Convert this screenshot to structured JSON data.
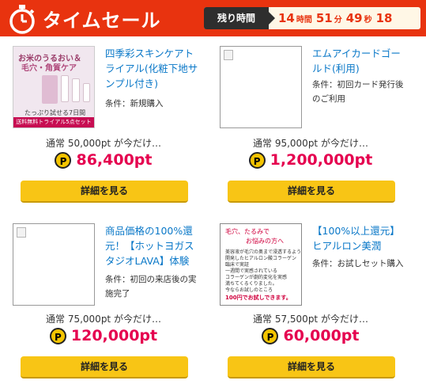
{
  "header": {
    "title": "タイムセール",
    "timer_label": "残り時間",
    "hours": "14",
    "hours_unit": "時間",
    "minutes": "51",
    "minutes_unit": "分",
    "seconds": "49",
    "seconds_unit": "秒",
    "frames": "18"
  },
  "items": [
    {
      "title": "四季彩スキンケアトライアル(化粧下地サンプル付き)",
      "condition": "条件：新規購入",
      "regular": "通常 50,000pt が今だけ…",
      "points": "86,400pt",
      "button": "詳細を見る",
      "image": {
        "line1": "お米のうるおい＆",
        "line2": "毛穴・角質ケア",
        "line3": "たっぷり試せる7日間",
        "band": "送料無料トライアル5点セット"
      }
    },
    {
      "title": "エムアイカードゴールド(利用)",
      "condition": "条件：初回カード発行後のご利用",
      "regular": "通常 95,000pt が今だけ…",
      "points": "1,200,000pt",
      "button": "詳細を見る"
    },
    {
      "title": "商品価格の100%還元！【ホットヨガスタジオLAVA】体験",
      "condition": "条件：初回の来店後の実施完了",
      "regular": "通常 75,000pt が今だけ…",
      "points": "120,000pt",
      "button": "詳細を見る"
    },
    {
      "title": "【100%以上還元】ヒアルロン美潤",
      "condition": "条件：お試しセット購入",
      "regular": "通常 57,500pt が今だけ…",
      "points": "60,000pt",
      "button": "詳細を見る",
      "image": {
        "head1": "毛穴、たるみで",
        "head2": "お悩みの方へ",
        "lines": [
          "美容液が毛穴の奥まで浸透するように",
          "開発したヒアルロン酸コラーゲン",
          "臨床で実証",
          "一週間で実感されている",
          "コラーゲンが劇的変化を実感",
          "満ちてくるくりました。",
          "今ならお試しのところ"
        ],
        "red": "100円でお試しできます。"
      }
    }
  ],
  "point_icon": "P",
  "colors": {
    "header": "#e8330f",
    "points": "#e5004f",
    "button": "#f8c515",
    "link": "#0a78c8"
  }
}
